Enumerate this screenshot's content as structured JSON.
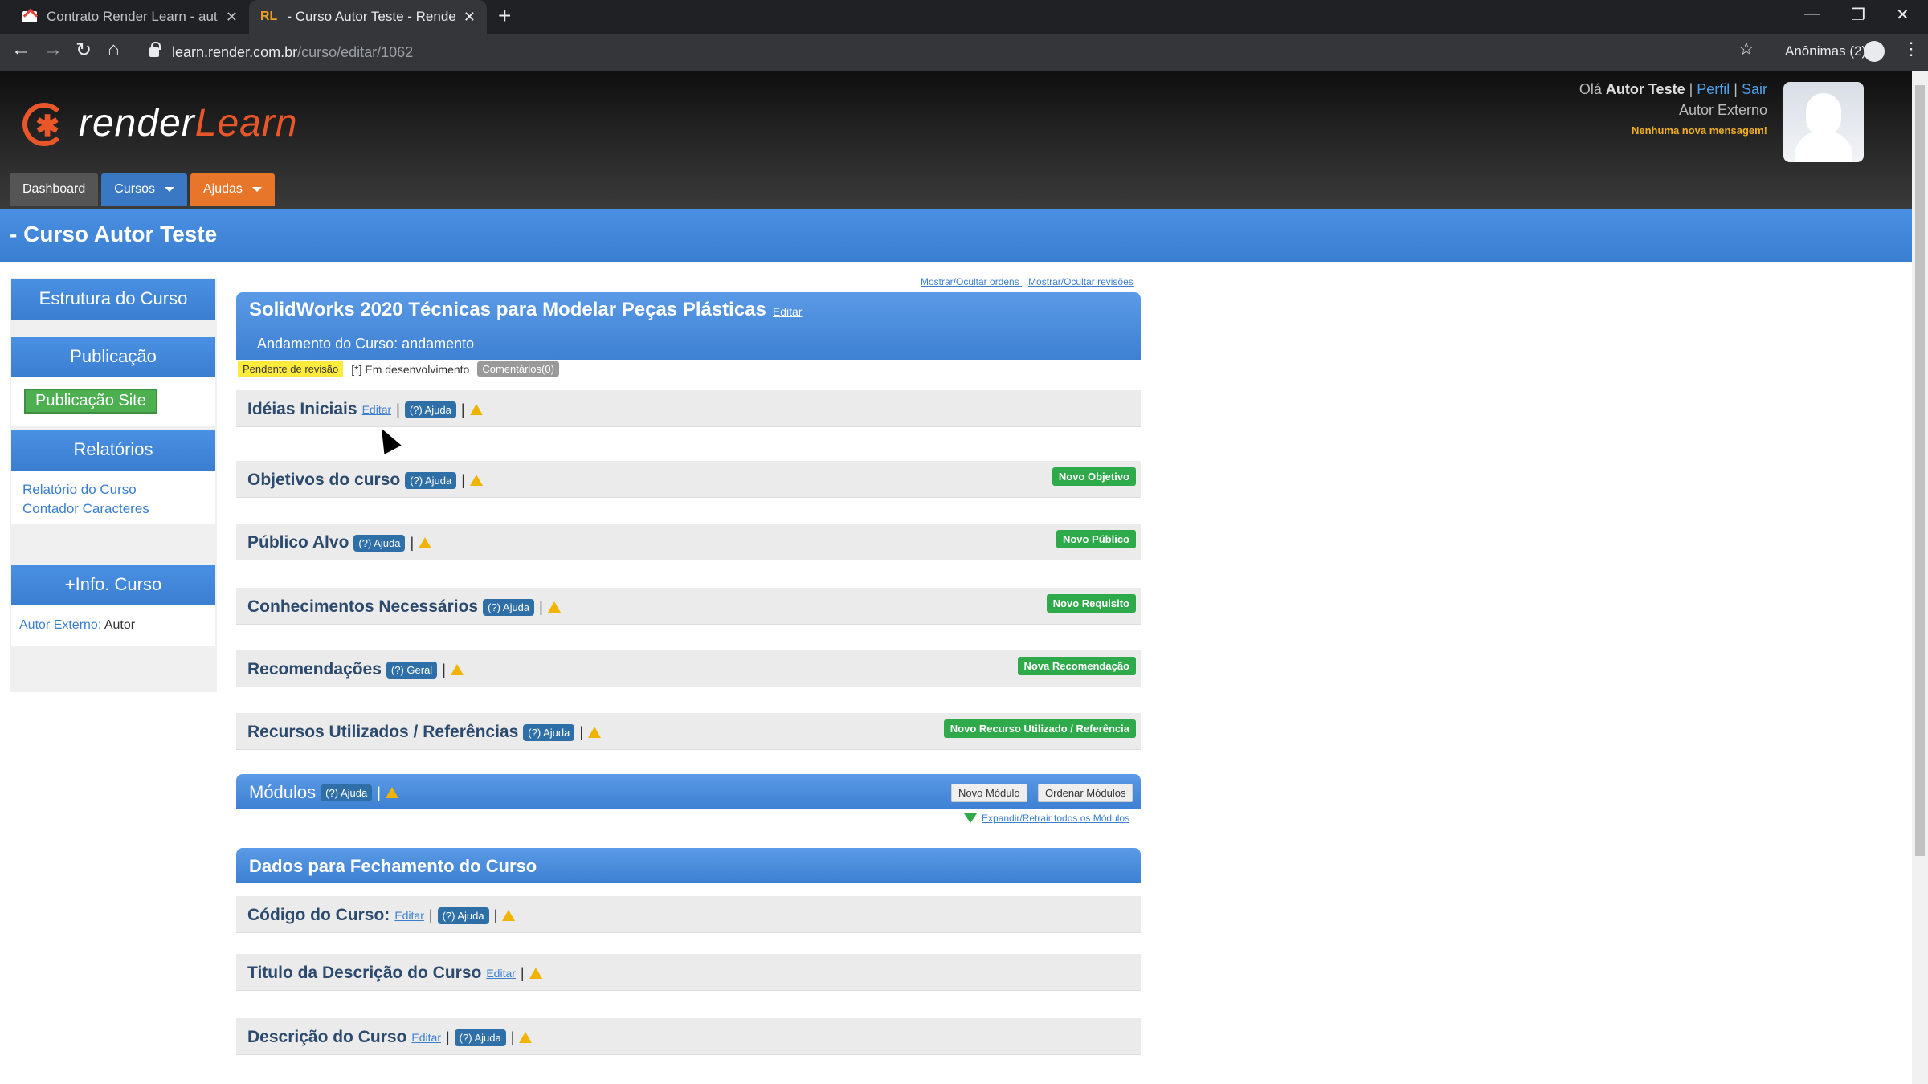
{
  "browser": {
    "tabs": [
      {
        "title": "Contrato Render Learn - autores"
      },
      {
        "title": "- Curso Autor Teste - Render Lea"
      }
    ],
    "url_host": "learn.render.com.br",
    "url_path": "/curso/editar/1062",
    "profile_label": "Anônimas (2)"
  },
  "header": {
    "logo_render": "render",
    "logo_learn": "Learn",
    "greeting": "Olá",
    "user_name": "Autor Teste",
    "profile_link": "Perfil",
    "logout_link": "Sair",
    "role": "Autor Externo",
    "messages": "Nenhuma nova mensagem!"
  },
  "nav": {
    "dashboard": "Dashboard",
    "courses": "Cursos",
    "help": "Ajudas"
  },
  "page_title": "- Curso Autor Teste",
  "sidebar": {
    "structure": "Estrutura do Curso",
    "publication": "Publicação",
    "publish_site": "Publicação Site",
    "reports": "Relatórios",
    "report_course": "Relatório do Curso",
    "char_counter": "Contador Caracteres",
    "info_title": "+Info. Curso",
    "author_label": "Autor Externo:",
    "author_value": "Autor"
  },
  "toggles": {
    "orders": "Mostrar/Ocultar ordens",
    "revisions": "Mostrar/Ocultar revisões"
  },
  "course": {
    "title": "SolidWorks 2020 Técnicas para Modelar Peças Plásticas",
    "edit": "Editar",
    "progress": "Andamento do Curso: andamento",
    "pending": "Pendente de revisão",
    "dev": "[*] Em desenvolvimento",
    "comments": "Comentários(0)"
  },
  "sections": {
    "ideias": {
      "label": "Idéias Iniciais",
      "edit": "Editar",
      "help": "(?) Ajuda"
    },
    "objetivos": {
      "label": "Objetivos do curso",
      "help": "(?) Ajuda",
      "button": "Novo Objetivo"
    },
    "publico": {
      "label": "Público Alvo",
      "help": "(?) Ajuda",
      "button": "Novo Público"
    },
    "conhecimentos": {
      "label": "Conhecimentos Necessários",
      "help": "(?) Ajuda",
      "button": "Novo Requisito"
    },
    "recomendacoes": {
      "label": "Recomendações",
      "help": "(?) Geral",
      "button": "Nova Recomendação"
    },
    "recursos": {
      "label": "Recursos Utilizados / Referências",
      "help": "(?) Ajuda",
      "button": "Novo Recurso Utilizado / Referência"
    }
  },
  "modules": {
    "label": "Módulos",
    "help": "(?) Ajuda",
    "new": "Novo Módulo",
    "order": "Ordenar Módulos",
    "expand": "Expandir/Retrair todos os Módulos"
  },
  "closing": {
    "title": "Dados para Fechamento do Curso",
    "codigo": {
      "label": "Código do Curso:",
      "edit": "Editar",
      "help": "(?) Ajuda"
    },
    "titulo": {
      "label": "Titulo da Descrição do Curso",
      "edit": "Editar"
    },
    "descricao": {
      "label": "Descrição do Curso",
      "edit": "Editar",
      "help": "(?) Ajuda"
    }
  }
}
